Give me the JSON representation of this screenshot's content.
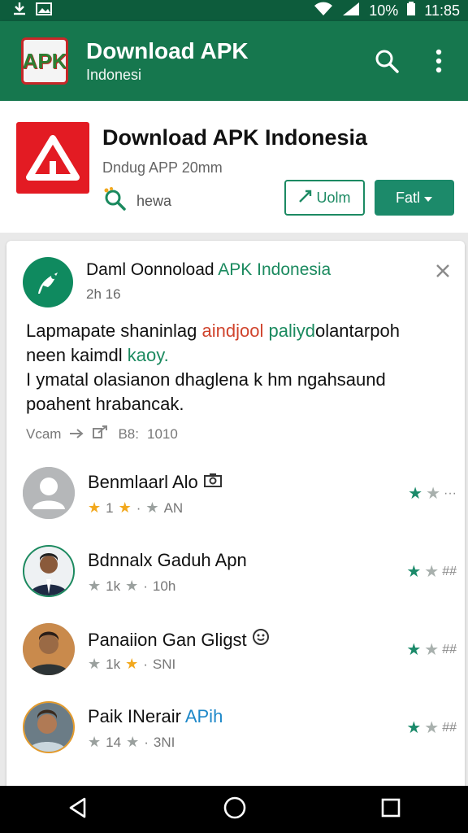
{
  "status_bar": {
    "battery": "10%",
    "time": "11:85",
    "icons": [
      "download-icon",
      "image-icon",
      "wifi-icon",
      "signal-icon",
      "battery-icon"
    ]
  },
  "app_bar": {
    "logo_text": "APK",
    "title": "Download APK",
    "subtitle": "Indonesi",
    "icons": [
      "search-icon",
      "more-vert-icon"
    ],
    "color": "#16774e"
  },
  "app_header": {
    "title": "Download APK Indonesia",
    "subtitle": "Dndug APP 20mm",
    "meta_label": "hewa",
    "outline_button": "Uolm",
    "filled_button": "Fatl",
    "icon_color": "#e31b23",
    "accent_color": "#1c8a6a"
  },
  "post": {
    "author_prefix": "Daml Oonnoload",
    "author_accent": "APK Indonesia",
    "time": "2h 16",
    "body": {
      "line1_start": "Lapmapate shaninlag ",
      "line1_red": "aindjool",
      "line1_mid": " ",
      "line1_green": "paliyd",
      "line1_end": "olantarpoh",
      "line2_start": "neen kaimdl ",
      "line2_green": "kaoy.",
      "line3": "I ymatal olasianon dhaglena k hm ngahsaund",
      "line4": "poahent hrabancak."
    },
    "actions": {
      "view": "Vcam",
      "count": "B8:",
      "number": "1010"
    }
  },
  "reviews": [
    {
      "name": "Benmlaarl Alo",
      "name_suffix": "",
      "meta_rating": "1",
      "meta_time": "AN",
      "avatar": "placeholder",
      "trail": "···"
    },
    {
      "name": "Bdnnalx Gaduh Apn",
      "name_suffix": "",
      "meta_rating": "1k",
      "meta_time": "10h",
      "avatar": "photo-suit",
      "trail": "##"
    },
    {
      "name": "Panaiion Gan Gligst",
      "name_suffix": "",
      "meta_rating": "1k",
      "meta_time": "SNI",
      "avatar": "photo-casual",
      "trail": "##"
    },
    {
      "name": "Paik INerair ",
      "name_suffix": "APih",
      "meta_rating": "14",
      "meta_time": "3NI",
      "avatar": "photo-selfie",
      "trail": "##"
    }
  ]
}
